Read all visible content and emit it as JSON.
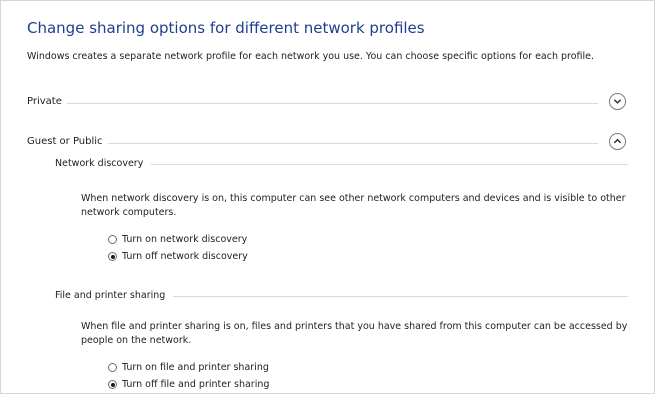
{
  "page": {
    "title": "Change sharing options for different network profiles",
    "description": "Windows creates a separate network profile for each network you use. You can choose specific options for each profile."
  },
  "profiles": {
    "private": {
      "label": "Private",
      "icon": "chevron-down-icon"
    },
    "guest_public": {
      "label": "Guest or Public",
      "icon": "chevron-up-icon"
    }
  },
  "network_discovery": {
    "heading": "Network discovery",
    "description": "When network discovery is on, this computer can see other network computers and devices and is visible to other network computers.",
    "options": [
      {
        "label": "Turn on network discovery",
        "selected": false
      },
      {
        "label": "Turn off network discovery",
        "selected": true
      }
    ]
  },
  "file_printer_sharing": {
    "heading": "File and printer sharing",
    "description": "When file and printer sharing is on, files and printers that you have shared from this computer can be accessed by people on the network.",
    "options": [
      {
        "label": "Turn on file and printer sharing",
        "selected": false
      },
      {
        "label": "Turn off file and printer sharing",
        "selected": true
      }
    ]
  },
  "colors": {
    "title": "#1e3f8f",
    "rule": "#dadada"
  }
}
